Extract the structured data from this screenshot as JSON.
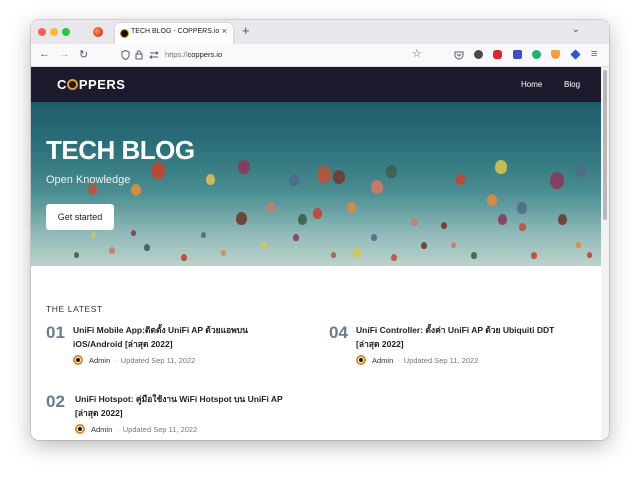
{
  "browser": {
    "tab_title": "TECH BLOG - COPPERS.io",
    "tab_close": "×",
    "new_tab": "+",
    "tab_list": "⌄",
    "url_scheme": "https://",
    "url_host": "coppers.io",
    "back": "←",
    "forward": "→",
    "reload": "↻",
    "bookmark": "☆",
    "menu": "≡"
  },
  "site": {
    "logo_pre": "C",
    "logo_post": "PPERS",
    "nav": [
      "Home",
      "Blog"
    ]
  },
  "hero": {
    "title": "TECH BLOG",
    "subtitle": "Open Knowledge",
    "button": "Get started"
  },
  "latest": {
    "heading": "THE LATEST",
    "posts": [
      {
        "num": "01",
        "title": "UniFi Mobile App:ติดตั้ง UniFi AP ด้วยแอพบน iOS/Android [ล่าสุด 2022]",
        "author": "Admin",
        "updated": "Updated Sep 11, 2022"
      },
      {
        "num": "04",
        "title": "UniFi Controller: ตั้งค่า UniFi AP ด้วย Ubiquiti DDT [ล่าสุด 2022]",
        "author": "Admin",
        "updated": "Updated Sep 11, 2022"
      },
      {
        "num": "02",
        "title": "UniFi Hotspot: คู่มือใช้งาน WiFi Hotspot บน UniFi AP [ล่าสุด 2022]",
        "author": "Admin",
        "updated": "Updated Sep 11, 2022"
      }
    ],
    "separator": "·"
  },
  "colors": {
    "header_bg": "#1c1a2c",
    "accent": "#e0a12b",
    "post_number": "#6b7a8c"
  }
}
